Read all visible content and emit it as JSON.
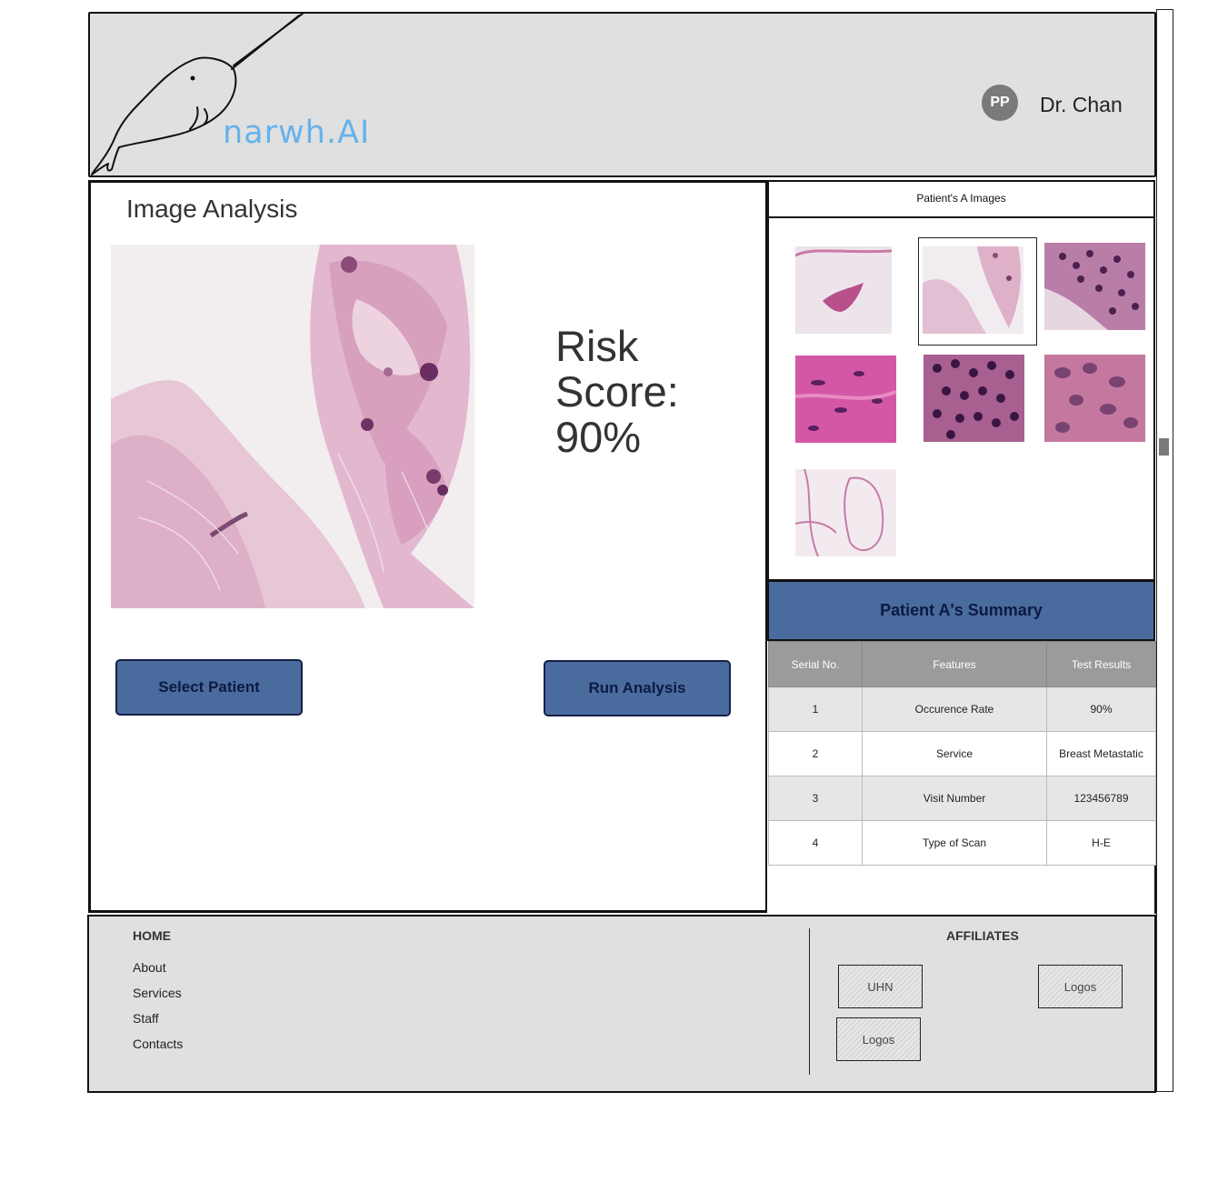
{
  "header": {
    "brand": "narwh.AI",
    "avatar_initials": "PP",
    "user_name": "Dr. Chan"
  },
  "main": {
    "title": "Image Analysis",
    "risk_score_label": "Risk Score:",
    "risk_score_value": "90%",
    "select_patient_label": "Select Patient",
    "run_analysis_label": "Run Analysis"
  },
  "gallery": {
    "title": "Patient's A Images",
    "selected_index": 1,
    "thumbnail_count": 7
  },
  "summary": {
    "title": "Patient A's Summary",
    "columns": [
      "Serial No.",
      "Features",
      "Test Results"
    ],
    "rows": [
      [
        "1",
        "Occurence Rate",
        "90%"
      ],
      [
        "2",
        "Service",
        "Breast Metastatic"
      ],
      [
        "3",
        "Visit Number",
        "123456789"
      ],
      [
        "4",
        "Type of Scan",
        "H-E"
      ]
    ]
  },
  "footer": {
    "home_label": "HOME",
    "links": [
      "About",
      "Services",
      "Staff",
      "Contacts"
    ],
    "affiliates_label": "AFFILIATES",
    "affiliates": [
      "UHN",
      "Logos",
      "Logos"
    ]
  },
  "colors": {
    "accent": "#4a6b9d",
    "brand": "#66b2ec",
    "header_bg": "#e0e0e0",
    "table_header": "#9b9b9b"
  },
  "icons": {
    "logo": "narwhal-sketch-icon",
    "avatar": "avatar-initials"
  }
}
